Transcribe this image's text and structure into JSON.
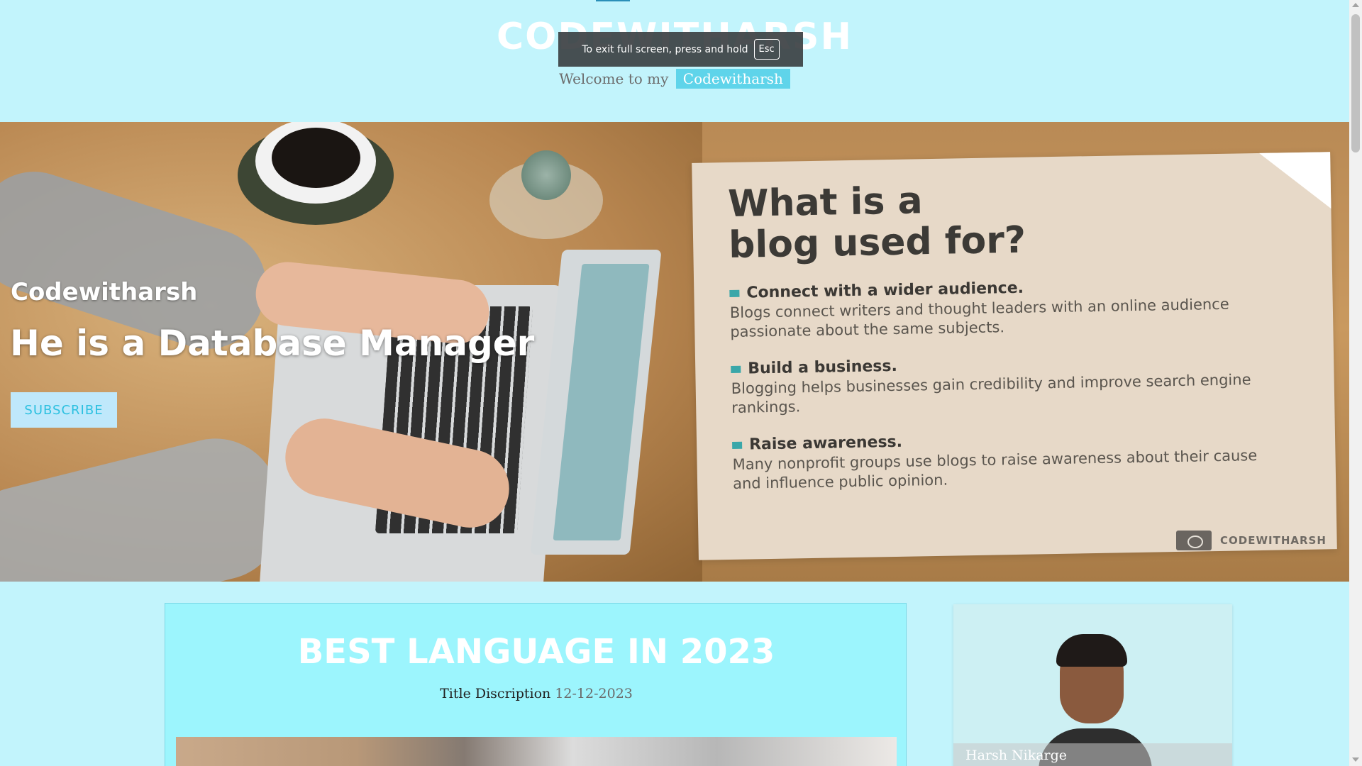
{
  "header": {
    "site_title": "CODEWITHARSH",
    "welcome_prefix": "Welcome to my",
    "welcome_highlight": "Codewitharsh"
  },
  "fullscreen_toast": {
    "message": "To exit full screen, press and hold",
    "key": "Esc"
  },
  "hero": {
    "name": "Codewitharsh",
    "tagline": "He is  a Database Manager",
    "subscribe_label": "SUBSCRIBE",
    "image_text": {
      "heading_line1": "What is a",
      "heading_line2": "blog used for?",
      "points": [
        {
          "title": "Connect with a wider audience.",
          "body": "Blogs connect writers and thought leaders with an online audience passionate about the same subjects."
        },
        {
          "title": "Build a business.",
          "body": "Blogging helps businesses gain credibility and improve search engine rankings."
        },
        {
          "title": "Raise awareness.",
          "body": "Many nonprofit groups use blogs to raise awareness about their cause and influence public opinion."
        }
      ],
      "watermark": "CODEWITHARSH"
    }
  },
  "post": {
    "title": "BEST LANGUAGE IN 2023",
    "description": "Title Discription",
    "date": "12-12-2023"
  },
  "author": {
    "name": "Harsh Nikarge"
  },
  "colors": {
    "page_bg": "#c2f4fc",
    "accent": "#5fd4ea",
    "post_card_bg": "#9cf5fd",
    "subscribe_bg": "#bfe8fb",
    "subscribe_text": "#2cc0e0"
  }
}
